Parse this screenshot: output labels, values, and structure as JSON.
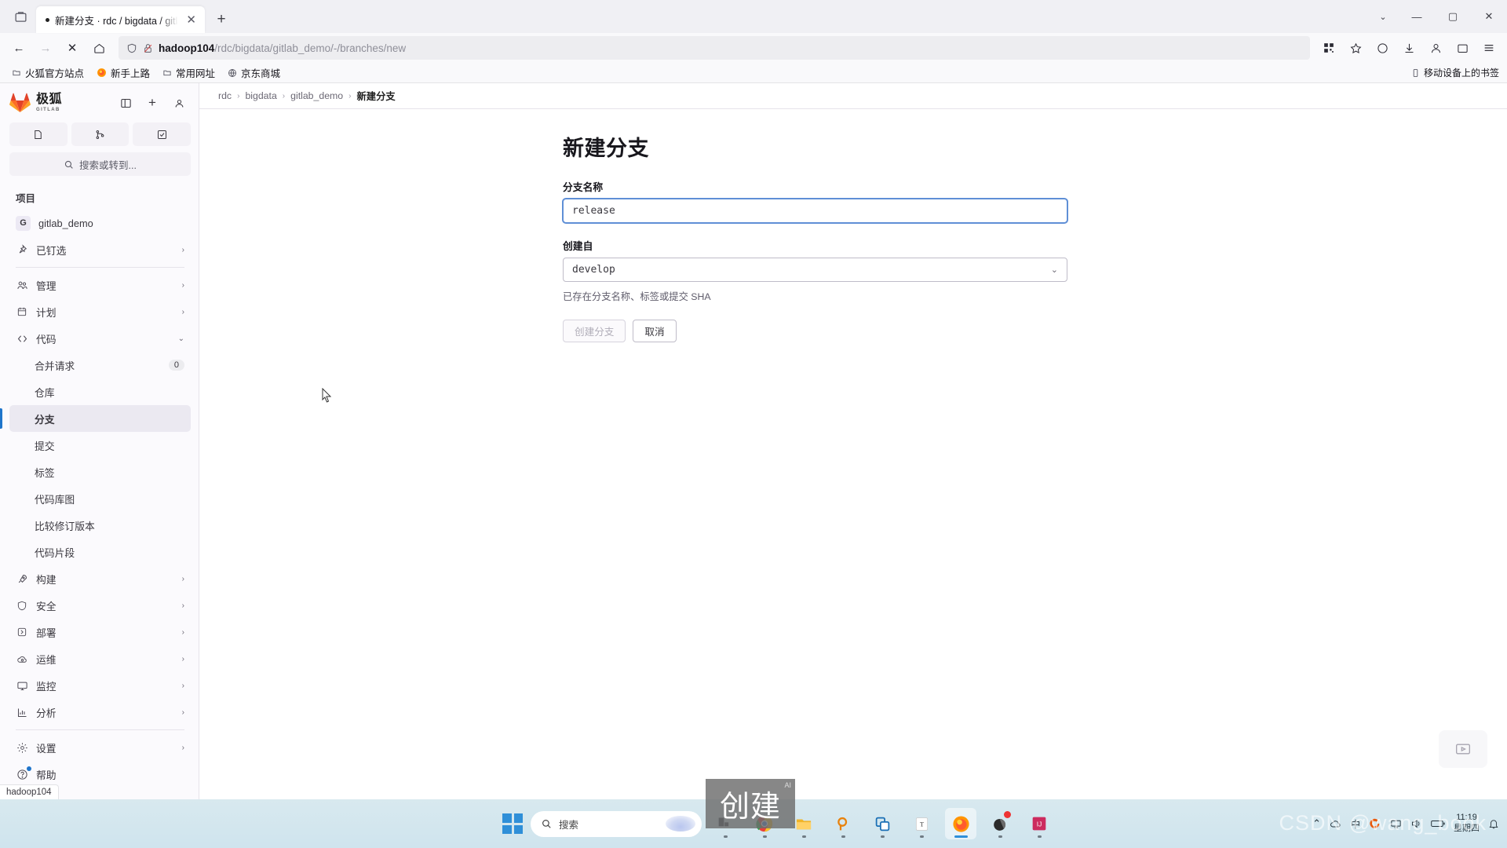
{
  "browser": {
    "tab": {
      "title": "新建分支 · rdc / bigdata / gitla",
      "close_label": "✕",
      "unread_dot": "●"
    },
    "newtab_label": "+",
    "window_controls": {
      "chevron": "⌄",
      "minimize": "—",
      "maximize": "▢",
      "close": "✕"
    },
    "nav": {
      "back": "←",
      "forward": "→",
      "stop": "✕",
      "home": "⌂"
    },
    "url": {
      "host": "hadoop104",
      "path": "/rdc/bigdata/gitlab_demo/-/branches/new",
      "shield_icon": "shield-icon",
      "lock_icon": "lock-crossed-icon"
    },
    "bookmarks": [
      {
        "label": "火狐官方站点",
        "icon": "folder-icon"
      },
      {
        "label": "新手上路",
        "icon": "firefox-icon"
      },
      {
        "label": "常用网址",
        "icon": "folder-icon"
      },
      {
        "label": "京东商城",
        "icon": "globe-icon"
      }
    ],
    "bookmarks_right": {
      "label": "移动设备上的书签",
      "icon": "mobile-bookmarks-icon"
    }
  },
  "gitlab": {
    "brand": {
      "name_cn": "极狐",
      "name_sub": "GITLAB"
    },
    "header_buttons": [
      {
        "name": "toggle-sidebar-button",
        "glyph": "▯"
      },
      {
        "name": "create-new-button",
        "glyph": "+"
      },
      {
        "name": "user-avatar-button",
        "glyph": "◔"
      }
    ],
    "quick_buttons": [
      {
        "name": "issues-button",
        "glyph": "issue-icon"
      },
      {
        "name": "merge-requests-button",
        "glyph": "merge-request-icon"
      },
      {
        "name": "todos-button",
        "glyph": "todo-check-icon"
      }
    ],
    "search": {
      "placeholder": "搜索或转到...",
      "icon": "search-icon"
    },
    "section_title": "项目",
    "project": {
      "initial": "G",
      "name": "gitlab_demo"
    },
    "nav_items": [
      {
        "label": "已钉选",
        "icon": "pin-icon",
        "chevron": "›",
        "level": "top"
      },
      {
        "label": "管理",
        "icon": "users-icon",
        "chevron": "›",
        "level": "top"
      },
      {
        "label": "计划",
        "icon": "calendar-icon",
        "chevron": "›",
        "level": "top"
      },
      {
        "label": "代码",
        "icon": "code-icon",
        "chevron": "⌄",
        "level": "top",
        "expanded": true
      },
      {
        "label": "合并请求",
        "level": "sub",
        "count": "0"
      },
      {
        "label": "仓库",
        "level": "sub"
      },
      {
        "label": "分支",
        "level": "sub",
        "active": true
      },
      {
        "label": "提交",
        "level": "sub"
      },
      {
        "label": "标签",
        "level": "sub"
      },
      {
        "label": "代码库图",
        "level": "sub"
      },
      {
        "label": "比较修订版本",
        "level": "sub"
      },
      {
        "label": "代码片段",
        "level": "sub"
      },
      {
        "label": "构建",
        "icon": "rocket-icon",
        "chevron": "›",
        "level": "top"
      },
      {
        "label": "安全",
        "icon": "shield-icon",
        "chevron": "›",
        "level": "top"
      },
      {
        "label": "部署",
        "icon": "deploy-icon",
        "chevron": "›",
        "level": "top"
      },
      {
        "label": "运维",
        "icon": "cloud-gear-icon",
        "chevron": "›",
        "level": "top"
      },
      {
        "label": "监控",
        "icon": "monitor-icon",
        "chevron": "›",
        "level": "top"
      },
      {
        "label": "分析",
        "icon": "chart-icon",
        "chevron": "›",
        "level": "top"
      },
      {
        "label": "设置",
        "icon": "gear-icon",
        "chevron": "›",
        "level": "top"
      }
    ],
    "help_item": {
      "label": "帮助",
      "icon": "question-icon"
    },
    "statusbar": "hadoop104"
  },
  "breadcrumb": [
    {
      "label": "rdc"
    },
    {
      "label": "bigdata"
    },
    {
      "label": "gitlab_demo"
    },
    {
      "label": "新建分支",
      "current": true
    }
  ],
  "form": {
    "title": "新建分支",
    "branch_name": {
      "label": "分支名称",
      "value": "release"
    },
    "create_from": {
      "label": "创建自",
      "value": "develop",
      "chevron": "⌄"
    },
    "help_text": "已存在分支名称、标签或提交 SHA",
    "submit_label": "创建分支",
    "cancel_label": "取消"
  },
  "ime": {
    "text": "创建",
    "ai_badge": "AI"
  },
  "taskbar": {
    "search_placeholder": "搜索",
    "icons": [
      {
        "name": "taskview-icon"
      },
      {
        "name": "chrome-icon"
      },
      {
        "name": "explorer-icon"
      },
      {
        "name": "search-everything-icon"
      },
      {
        "name": "vmware-icon"
      },
      {
        "name": "typora-icon"
      },
      {
        "name": "firefox-icon",
        "active": true
      },
      {
        "name": "notification-app-icon",
        "badge": true
      },
      {
        "name": "jetbrains-icon"
      }
    ],
    "tray": [
      {
        "name": "show-hidden-icons",
        "glyph": "⌃"
      },
      {
        "name": "onedrive-icon"
      },
      {
        "name": "ime-indicator",
        "glyph": "中"
      },
      {
        "name": "sogou-icon"
      },
      {
        "name": "network-icon"
      },
      {
        "name": "volume-icon"
      },
      {
        "name": "battery-icon"
      }
    ],
    "clock": {
      "time": "11:19",
      "date": "星期四"
    }
  },
  "watermark": "CSDN @wang_book"
}
